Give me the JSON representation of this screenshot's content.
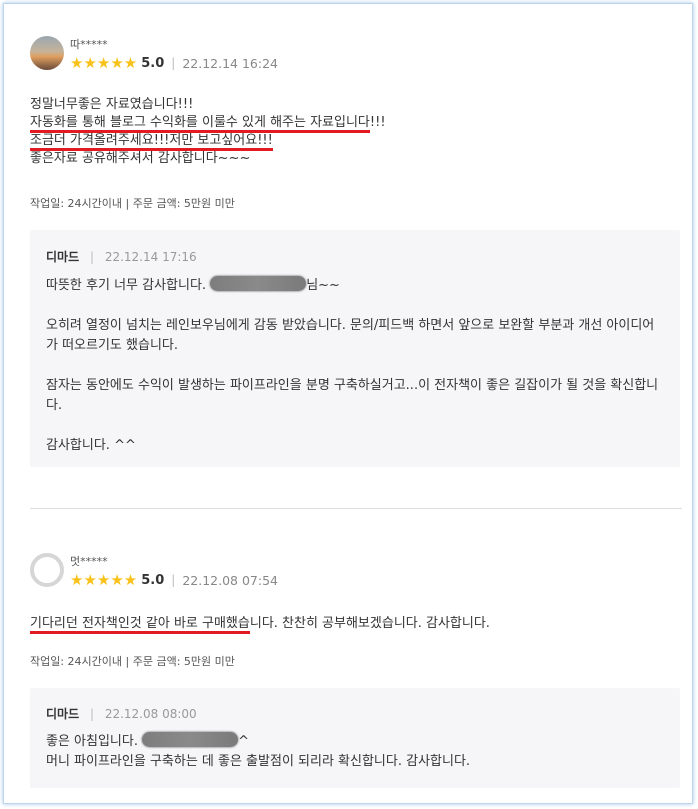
{
  "review1": {
    "nickname": "따*****",
    "stars": "★★★★★",
    "score": "5.0",
    "separator": "|",
    "date": "22.12.14 16:24",
    "lines": [
      "정말너무좋은 자료였습니다!!!",
      "자동화를 통해 블로그 수익화를 이룰수 있게 해주는 자료입니다",
      "!!!",
      "조금더 가격올려주세요!!!저만 보고싶어요!!!",
      "좋은자료 공유해주셔서 감사합니다~~~"
    ],
    "meta": "작업일: 24시간이내 | 주문 금액: 5만원 미만",
    "reply": {
      "author": "디마드",
      "separator": "|",
      "date": "22.12.14 17:16",
      "line1_before": "따뜻한 후기 너무 감사합니다. ",
      "line1_after": "님~~",
      "para2": "오히려 열정이 넘치는 레인보우님에게 감동 받았습니다. 문의/피드백 하면서 앞으로 보완할 부분과 개선 아이디어가 떠오르기도 했습니다.",
      "para3": "잠자는 동안에도 수익이 발생하는 파이프라인을 분명 구축하실거고...이 전자책이 좋은 길잡이가 될 것을 확신합니다.",
      "para4": "감사합니다. ^^"
    }
  },
  "review2": {
    "nickname": "멋*****",
    "stars": "★★★★★",
    "score": "5.0",
    "separator": "|",
    "date": "22.12.08 07:54",
    "text_underlined": "기다리던 전자책인것 같아 바로 구매했습",
    "text_rest": "니다. 찬찬히 공부해보겠습니다. 감사합니다.",
    "meta": "작업일: 24시간이내 | 주문 금액: 5만원 미만",
    "reply": {
      "author": "디마드",
      "separator": "|",
      "date": "22.12.08 08:00",
      "line1_before": "좋은 아침입니다. ",
      "line1_after": "^",
      "line2": "머니 파이프라인을 구축하는 데 좋은 출발점이 되리라 확신합니다.  감사합니다."
    }
  },
  "colors": {
    "star": "#f8c21b",
    "underline": "#e21b23",
    "reply_bg": "#f6f6f8"
  }
}
